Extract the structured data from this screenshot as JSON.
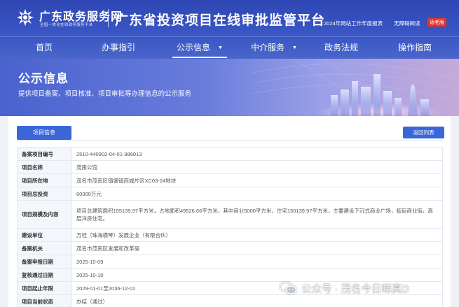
{
  "header": {
    "logo_main": "广东政务服务网",
    "logo_sub": "全国一体化在线政务服务平台",
    "platform_title": "广东省投资项目在线审批监管平台",
    "link_report": "2024年网站工作年度报表",
    "link_accessible": "无障碍阅读",
    "elder_mode": "适老版"
  },
  "nav": {
    "items": [
      {
        "label": "首页"
      },
      {
        "label": "办事指引"
      },
      {
        "label": "公示信息",
        "arrow": "▼"
      },
      {
        "label": "中介服务",
        "arrow": "▼"
      },
      {
        "label": "政务法规"
      },
      {
        "label": "操作指南"
      }
    ]
  },
  "banner": {
    "title": "公示信息",
    "subtitle": "提供项目备案、项目核准、项目审批等办理信息的公示服务"
  },
  "panel": {
    "tab_label": "项目信息",
    "back_label": "返回列表"
  },
  "project": {
    "rows": [
      {
        "key": "备案项目编号",
        "value": "2510-440902-04-01-986013"
      },
      {
        "key": "项目名称",
        "value": "茂南公馆"
      },
      {
        "key": "项目所在地",
        "value": "茂名市茂南区镇盛镇西城片区XC03-24地块"
      },
      {
        "key": "项目总投资",
        "value": "60000万元"
      },
      {
        "key": "项目规模及内容",
        "value": "项目总建筑面积155139.97平方米，占地面积49526.66平方米，其中商业5000平方米，住宅150139.97平方米，主要建设下沉式商业广场，临街商业街，高层洋房住宅。"
      },
      {
        "key": "建设单位",
        "value": "万桂（珠海横琴）发展企业（有限合伙）"
      },
      {
        "key": "备案机关",
        "value": "茂名市茂南区发展和改革局"
      },
      {
        "key": "备案申报日期",
        "value": "2025-10-09"
      },
      {
        "key": "复核通过日期",
        "value": "2025-10-10"
      },
      {
        "key": "项目起止年限",
        "value": "2029-01-01至2036-12-01"
      },
      {
        "key": "项目当前状态",
        "value": "办结（通过）"
      }
    ]
  },
  "watermark": {
    "text": "公众号 · 茂名今日睇真D"
  },
  "colors": {
    "header_blue": "#2e46b4",
    "button_blue": "#3a66d8",
    "elder_red": "#e2342b"
  }
}
